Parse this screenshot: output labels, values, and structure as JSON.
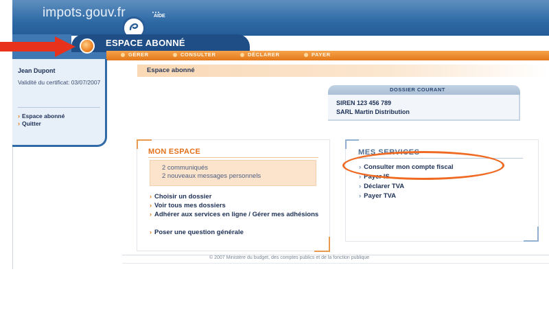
{
  "header": {
    "logo_text": "impots.gouv.fr",
    "help_link": "AIDE",
    "section_title": "ESPACE ABONNÉ"
  },
  "nav": {
    "items": [
      {
        "label": "GÉRER"
      },
      {
        "label": "CONSULTER"
      },
      {
        "label": "DÉCLARER"
      },
      {
        "label": "PAYER"
      }
    ]
  },
  "breadcrumb": {
    "title": "Espace abonné"
  },
  "sidebar": {
    "user_name": "Jean Dupont",
    "certificate_label": "Validité du certificat: 03/07/2007",
    "links": [
      {
        "label": "Espace abonné"
      },
      {
        "label": "Quitter"
      }
    ]
  },
  "dossier": {
    "title": "DOSSIER COURANT",
    "siren": "SIREN 123 456 789",
    "company": "SARL Martin Distribution"
  },
  "mon_espace": {
    "title": "MON ESPACE",
    "notifications": [
      "2 communiqués",
      "2 nouveaux messages personnels"
    ],
    "links": [
      {
        "label": "Choisir un dossier"
      },
      {
        "label": "Voir tous mes dossiers"
      },
      {
        "label": "Adhérer aux services en ligne / Gérer mes adhésions"
      },
      {
        "label": "Poser une question générale"
      }
    ]
  },
  "mes_services": {
    "title": "MES SERVICES",
    "links": [
      {
        "label": "Consulter mon compte fiscal"
      },
      {
        "label": "Payer IS"
      },
      {
        "label": "Déclarer TVA"
      },
      {
        "label": "Payer TVA"
      }
    ]
  },
  "footer": {
    "text": "© 2007 Ministère du budget, des comptes publics et de la fonction publique"
  },
  "colors": {
    "banner_blue": "#2f6aa6",
    "tab_navy": "#1f4d86",
    "nav_orange": "#e4781a",
    "highlight_red": "#e8321c",
    "ellipse_orange": "#ef6a22"
  }
}
